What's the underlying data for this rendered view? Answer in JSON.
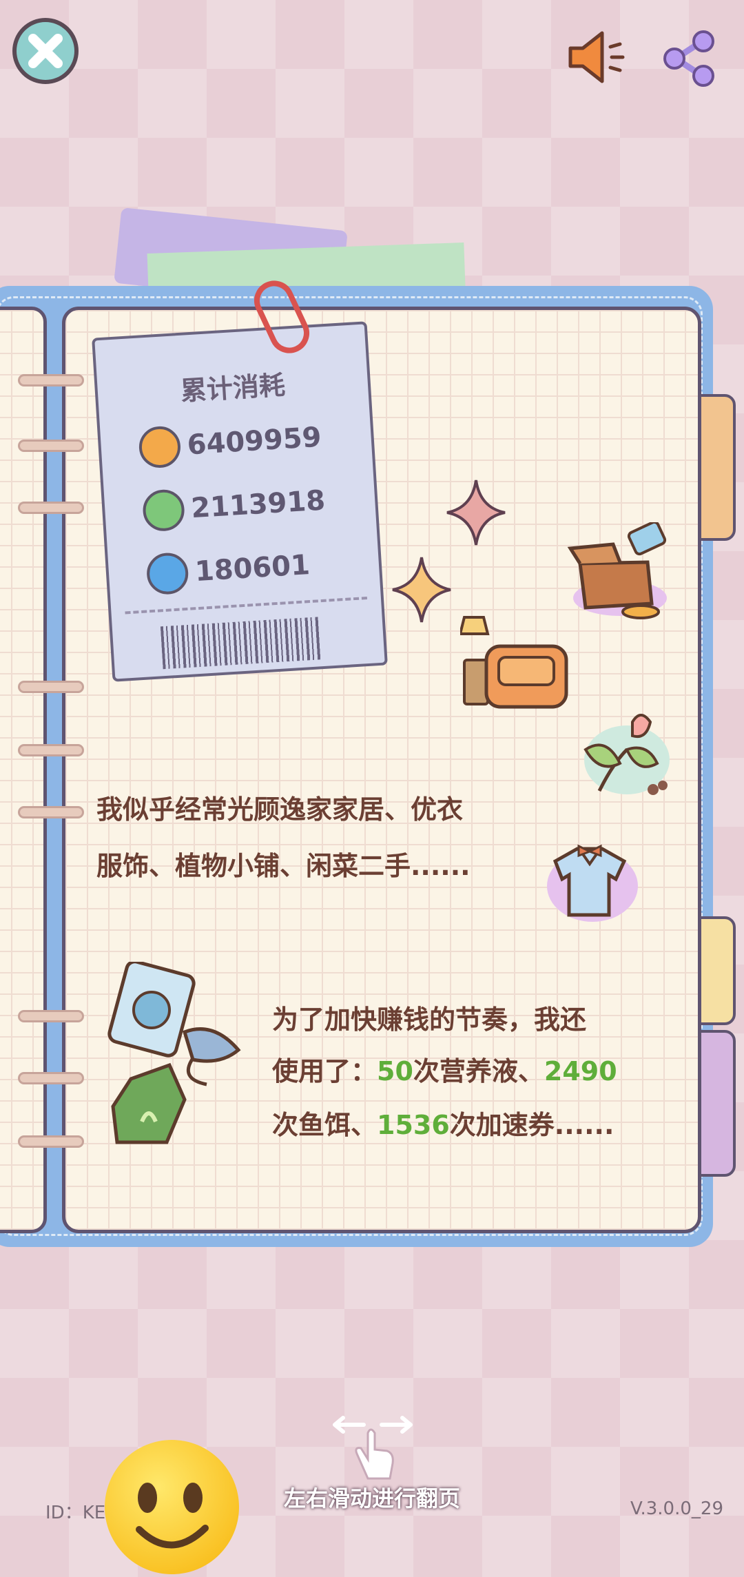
{
  "header": {
    "close_icon": "close-icon",
    "sound_icon": "speaker-icon",
    "share_icon": "share-icon"
  },
  "ticket": {
    "title": "累计消耗",
    "rows": [
      {
        "icon": "orange-coin-icon",
        "value": "6409959",
        "color": "#f3a94a"
      },
      {
        "icon": "green-leaf-coin-icon",
        "value": "2113918",
        "color": "#7ec77a"
      },
      {
        "icon": "blue-swirl-coin-icon",
        "value": "180601",
        "color": "#5aa7e6"
      }
    ]
  },
  "text1": {
    "line1": "我似乎经常光顾逸家家居、优衣",
    "line2": "服饰、植物小铺、闲菜二手......"
  },
  "text2": {
    "line1": "为了加快赚钱的节奏，我还",
    "l2_prefix": "使用了：",
    "l2_n1": "50",
    "l2_mid": "次营养液、",
    "l2_n2": "2490",
    "l3_prefix": "次鱼饵、",
    "l3_n": "1536",
    "l3_suffix": "次加速券......"
  },
  "footer": {
    "hint": "左右滑动进行翻页",
    "id_label": "ID：KE",
    "version": "V.3.0.0_29"
  },
  "colors": {
    "accent_green": "#5fae3a",
    "text_brown": "#6b3f33",
    "notebook_blue": "#8db6e6"
  }
}
